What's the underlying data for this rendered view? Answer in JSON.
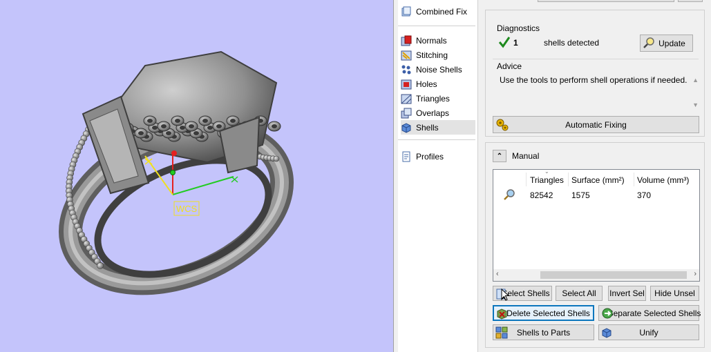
{
  "viewport": {
    "axis_label": "WCS",
    "background": "#c4c4fb"
  },
  "tools": {
    "items": [
      {
        "label": "Combined Fix",
        "icon": "combined-fix-icon"
      },
      {
        "label": "Normals",
        "icon": "normals-icon"
      },
      {
        "label": "Stitching",
        "icon": "stitching-icon"
      },
      {
        "label": "Noise Shells",
        "icon": "noise-shells-icon"
      },
      {
        "label": "Holes",
        "icon": "holes-icon"
      },
      {
        "label": "Triangles",
        "icon": "triangles-icon"
      },
      {
        "label": "Overlaps",
        "icon": "overlaps-icon"
      },
      {
        "label": "Shells",
        "icon": "shells-icon",
        "selected": true
      },
      {
        "label": "Profiles",
        "icon": "profiles-icon"
      }
    ]
  },
  "diagnostics": {
    "title": "Diagnostics",
    "count": "1",
    "status_text": "shells detected",
    "update_label": "Update"
  },
  "advice": {
    "title": "Advice",
    "text": "Use the tools to perform shell operations if needed."
  },
  "automatic_fixing_label": "Automatic Fixing",
  "manual": {
    "title": "Manual",
    "columns": [
      "Triangles",
      "Surface (mm²)",
      "Volume (mm³)"
    ],
    "rows": [
      {
        "triangles": "82542",
        "surface": "1575",
        "volume": "370"
      }
    ]
  },
  "buttons": {
    "select_shells": "Select Shells",
    "select_all": "Select All",
    "invert_sel": "Invert Sel",
    "hide_unsel": "Hide Unsel",
    "delete_selected_shells": "Delete Selected Shells",
    "separate_selected_shells": "Separate Selected Shells",
    "shells_to_parts": "Shells to Parts",
    "unify": "Unify"
  }
}
